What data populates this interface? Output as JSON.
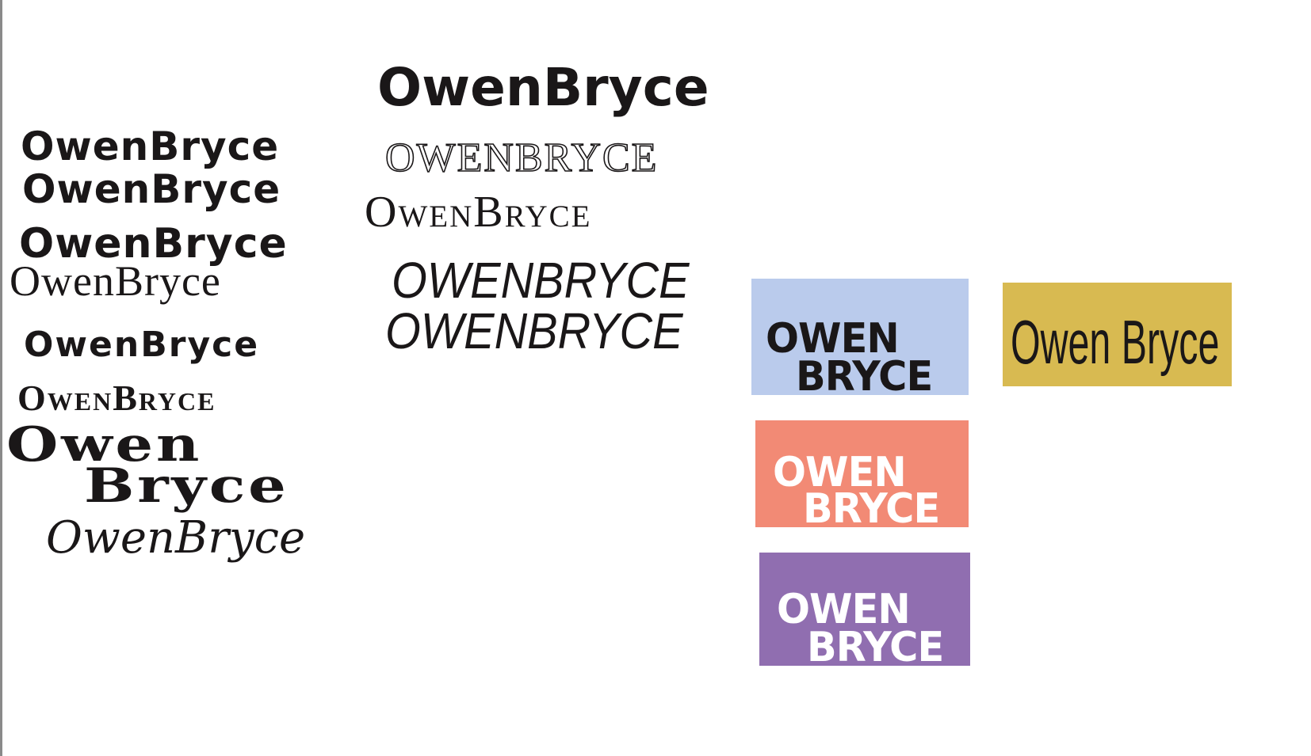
{
  "samples": {
    "s1": "OwenBryce",
    "s2": "OwenBryce",
    "s3": "OwenBryce",
    "s4": "OwenBryce",
    "s5": "OwenBryce",
    "s6": "OwenBryce",
    "s7_line1": "Owen",
    "s7_line2": "Bryce",
    "s8": "OwenBryce",
    "m1": "OwenBryce",
    "m2": "OWENBRYCE",
    "m3": "OwenBryce",
    "m4": "OWENBRYCE",
    "m5": "OWENBRYCE"
  },
  "blocks": {
    "blue": {
      "line1": "OWEN",
      "line2": "BRYCE",
      "color": "#bacbec"
    },
    "salmon": {
      "line1": "OWEN",
      "line2": "BRYCE",
      "color": "#f28a75"
    },
    "purple": {
      "line1": "OWEN",
      "line2": "BRYCE",
      "color": "#906eb0"
    },
    "gold": {
      "text": "Owen Bryce",
      "color": "#d8ba51"
    }
  }
}
